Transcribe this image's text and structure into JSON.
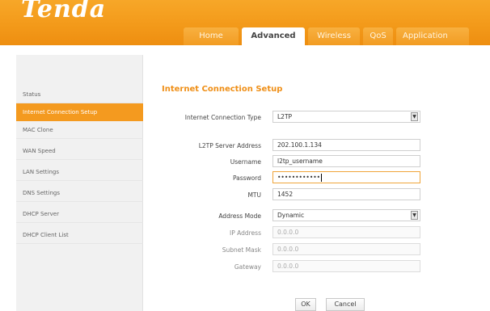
{
  "header": {
    "logo_text": "Tenda",
    "tabs": [
      "Home",
      "Advanced",
      "Wireless",
      "QoS",
      "Application"
    ],
    "active_tab": "Advanced",
    "brand_color": "#f39a1a"
  },
  "sidebar": {
    "items": [
      "Status",
      "Internet Connection Setup",
      "MAC Clone",
      "WAN Speed",
      "LAN Settings",
      "DNS Settings",
      "DHCP Server",
      "DHCP Client List"
    ],
    "active_item": "Internet Connection Setup"
  },
  "main": {
    "title": "Internet Connection Setup",
    "fields": {
      "connection_type": {
        "label": "Internet Connection Type",
        "value": "L2TP"
      },
      "server_address": {
        "label": "L2TP Server Address",
        "value": "202.100.1.134"
      },
      "username": {
        "label": "Username",
        "value": "l2tp_username"
      },
      "password": {
        "label": "Password",
        "value": "••••••••••••"
      },
      "mtu": {
        "label": "MTU",
        "value": "1452"
      },
      "address_mode": {
        "label": "Address Mode",
        "value": "Dynamic"
      },
      "ip_address": {
        "label": "IP Address",
        "value": "0.0.0.0"
      },
      "subnet_mask": {
        "label": "Subnet Mask",
        "value": "0.0.0.0"
      },
      "gateway": {
        "label": "Gateway",
        "value": "0.0.0.0"
      }
    },
    "buttons": {
      "ok": "OK",
      "cancel": "Cancel"
    }
  }
}
